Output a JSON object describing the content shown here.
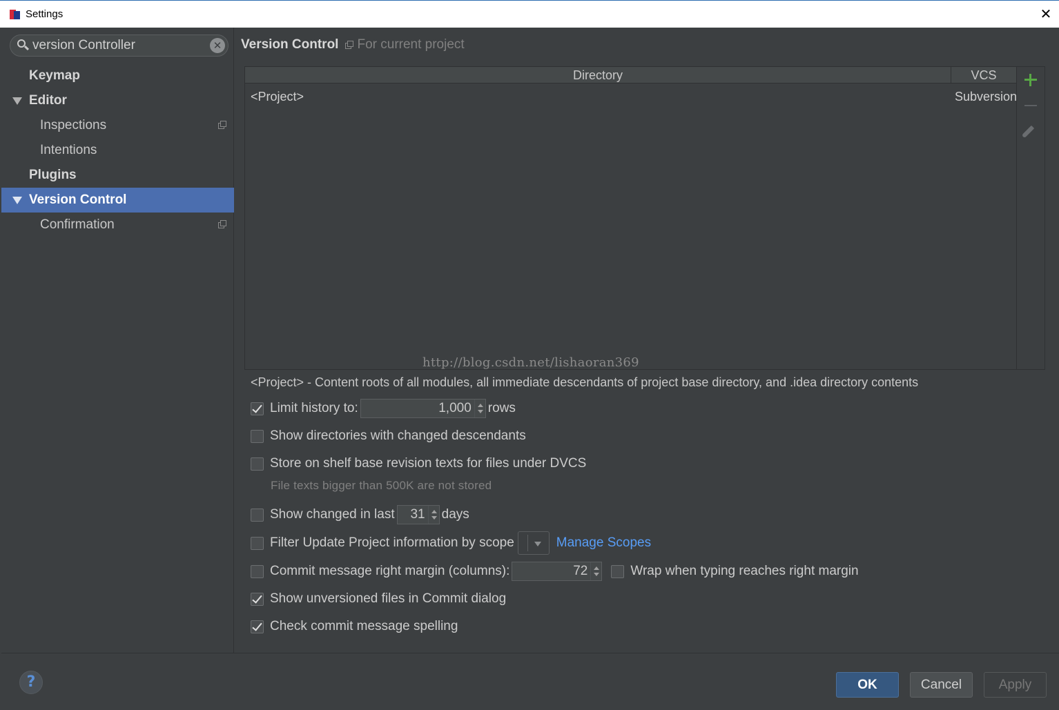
{
  "window": {
    "title": "Settings",
    "close_label": "✕"
  },
  "search": {
    "value": "version Controller",
    "clear_label": "✕"
  },
  "tree": [
    {
      "label": "Keymap",
      "bold": true,
      "expanded": null,
      "indent": 1,
      "selected": false,
      "project_icon": false
    },
    {
      "label": "Editor",
      "bold": true,
      "expanded": true,
      "indent": 1,
      "selected": false,
      "project_icon": false
    },
    {
      "label": "Inspections",
      "bold": false,
      "expanded": null,
      "indent": 2,
      "selected": false,
      "project_icon": true
    },
    {
      "label": "Intentions",
      "bold": false,
      "expanded": null,
      "indent": 2,
      "selected": false,
      "project_icon": false
    },
    {
      "label": "Plugins",
      "bold": true,
      "expanded": null,
      "indent": 1,
      "selected": false,
      "project_icon": false
    },
    {
      "label": "Version Control",
      "bold": true,
      "expanded": true,
      "indent": 1,
      "selected": true,
      "project_icon": false
    },
    {
      "label": "Confirmation",
      "bold": false,
      "expanded": null,
      "indent": 2,
      "selected": false,
      "project_icon": true
    }
  ],
  "header": {
    "title": "Version Control",
    "scope": "For current project"
  },
  "mappings": {
    "columns": [
      "Directory",
      "VCS"
    ],
    "rows": [
      {
        "directory": "<Project>",
        "vcs": "Subversion"
      }
    ],
    "watermark": "http://blog.csdn.net/lishaoran369"
  },
  "description": "<Project> - Content roots of all modules, all immediate descendants of project base directory, and .idea directory contents",
  "options": {
    "limit_history": {
      "label": "Limit history to:",
      "checked": true,
      "value": "1,000",
      "suffix": "rows"
    },
    "show_dirs": {
      "label": "Show directories with changed descendants",
      "checked": false
    },
    "store_shelf": {
      "label": "Store on shelf base revision texts for files under DVCS",
      "checked": false,
      "hint": "File texts bigger than 500K are not stored"
    },
    "show_changed": {
      "label": "Show changed in last",
      "checked": false,
      "value": "31",
      "suffix": "days"
    },
    "filter_scope": {
      "label": "Filter Update Project information by scope",
      "checked": false,
      "link": "Manage Scopes"
    },
    "commit_margin": {
      "label": "Commit message right margin (columns):",
      "checked": false,
      "value": "72"
    },
    "wrap_typing": {
      "label": "Wrap when typing reaches right margin",
      "checked": false
    },
    "show_unversioned": {
      "label": "Show unversioned files in Commit dialog",
      "checked": true
    },
    "check_spelling": {
      "label": "Check commit message spelling",
      "checked": true
    }
  },
  "buttons": {
    "help": "?",
    "ok": "OK",
    "cancel": "Cancel",
    "apply": "Apply"
  },
  "colors": {
    "background": "#3c3f41",
    "selection": "#4b6eaf",
    "link": "#589df6",
    "add_icon": "#58a845",
    "ok_button": "#365880"
  }
}
